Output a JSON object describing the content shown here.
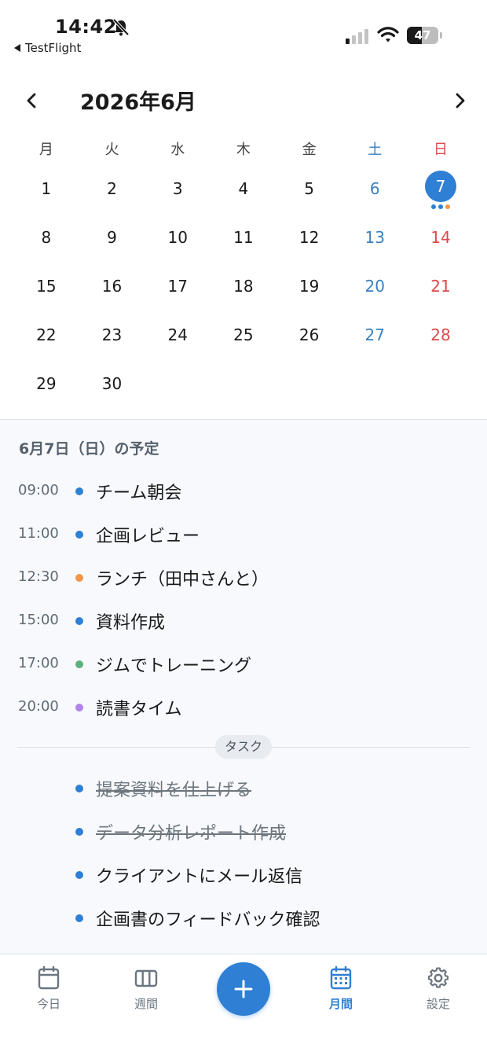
{
  "status_bar": {
    "time": "14:42",
    "back_app": "TestFlight",
    "battery_level": "47",
    "battery_fraction": 0.47
  },
  "calendar": {
    "month_title": "2026年6月",
    "prev_icon": "chevron-left-icon",
    "next_icon": "chevron-right-icon",
    "weekdays": [
      "月",
      "火",
      "水",
      "木",
      "金",
      "土",
      "日"
    ],
    "weeks": [
      [
        "1",
        "2",
        "3",
        "4",
        "5",
        "6",
        "7"
      ],
      [
        "8",
        "9",
        "10",
        "11",
        "12",
        "13",
        "14"
      ],
      [
        "15",
        "16",
        "17",
        "18",
        "19",
        "20",
        "21"
      ],
      [
        "22",
        "23",
        "24",
        "25",
        "26",
        "27",
        "28"
      ],
      [
        "29",
        "30",
        "",
        "",
        "",
        "",
        ""
      ]
    ],
    "selected_day": "7",
    "selected_day_dot_colors": [
      "#2f7fd4",
      "#2f7fd4",
      "#f0974a"
    ]
  },
  "schedule": {
    "title": "6月7日（日）の予定",
    "events": [
      {
        "time": "09:00",
        "title": "チーム朝会",
        "color": "#2f7fd4"
      },
      {
        "time": "11:00",
        "title": "企画レビュー",
        "color": "#2f7fd4"
      },
      {
        "time": "12:30",
        "title": "ランチ（田中さんと）",
        "color": "#f0974a"
      },
      {
        "time": "15:00",
        "title": "資料作成",
        "color": "#2f7fd4"
      },
      {
        "time": "17:00",
        "title": "ジムでトレーニング",
        "color": "#5db07e"
      },
      {
        "time": "20:00",
        "title": "読書タイム",
        "color": "#b083e8"
      }
    ],
    "task_label": "タスク",
    "tasks": [
      {
        "title": "提案資料を仕上げる",
        "done": true
      },
      {
        "title": "データ分析レポート作成",
        "done": true
      },
      {
        "title": "クライアントにメール返信",
        "done": false
      },
      {
        "title": "企画書のフィードバック確認",
        "done": false
      }
    ]
  },
  "tab_bar": {
    "tabs": [
      {
        "label": "今日",
        "icon": "calendar-day-icon"
      },
      {
        "label": "週間",
        "icon": "columns-icon"
      },
      {
        "label": "月間",
        "icon": "calendar-month-icon"
      },
      {
        "label": "設定",
        "icon": "gear-icon"
      }
    ],
    "add_icon": "plus-icon",
    "active_tab": "月間"
  },
  "colors": {
    "accent": "#2f7fd4",
    "saturday": "#3a80c2",
    "sunday": "#dd4a4a"
  }
}
